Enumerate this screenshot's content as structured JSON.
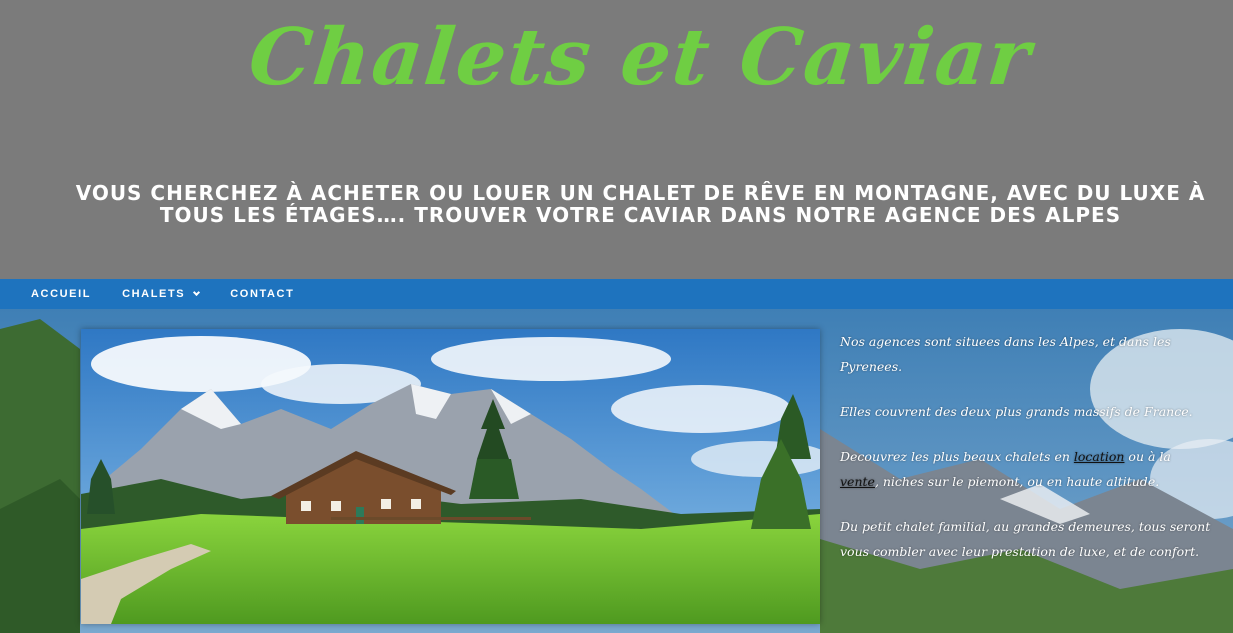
{
  "header": {
    "site_title": "Chalets et Caviar",
    "tagline": "VOUS CHERCHEZ À ACHETER OU LOUER UN CHALET DE RÊVE EN MONTAGNE, AVEC DU LUXE À TOUS LES ÉTAGES…. TROUVER VOTRE CAVIAR DANS NOTRE AGENCE DES ALPES"
  },
  "nav": {
    "items": [
      {
        "label": "ACCUEIL"
      },
      {
        "label": "CHALETS",
        "icon": "chevron-down-icon"
      },
      {
        "label": "CONTACT"
      }
    ]
  },
  "content": {
    "p1": "Nos agences sont situees dans les Alpes, et dans les Pyrenees.",
    "p2": "Elles couvrent des deux plus grands massifs de France.",
    "p3_before": "Decouvrez les plus beaux chalets en ",
    "p3_link1": "location",
    "p3_middle": " ou à la ",
    "p3_link2": "vente",
    "p3_after": ", niches sur le piemont, ou en haute altitude.",
    "p4": "Du petit chalet familial, au grandes demeures, tous seront vous combler avec leur prestation de luxe, et de confort."
  },
  "colors": {
    "title_green": "#6fce43",
    "header_gray": "#7b7b7b",
    "nav_blue": "#1e73be"
  }
}
